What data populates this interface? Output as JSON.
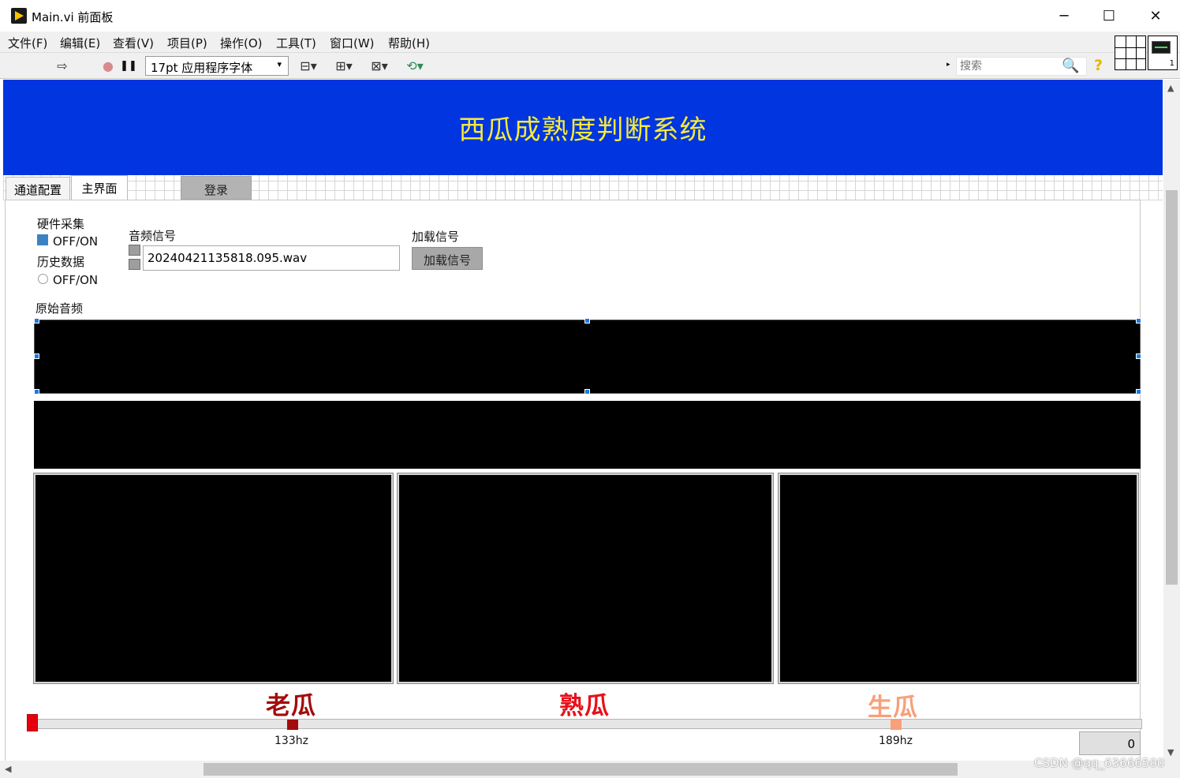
{
  "window": {
    "title": "Main.vi 前面板",
    "minimize": "─",
    "maximize": "☐",
    "close": "✕"
  },
  "menu": [
    "文件(F)",
    "编辑(E)",
    "查看(V)",
    "项目(P)",
    "操作(O)",
    "工具(T)",
    "窗口(W)",
    "帮助(H)"
  ],
  "toolbar": {
    "run_icon": "⇨",
    "abort_icon": "●",
    "pause_icon": "❚❚",
    "font": "17pt 应用程序字体",
    "font_arrow": "▾",
    "align_icon": "⊟▾",
    "distribute_icon": "⊞▾",
    "resize_icon": "⊠▾",
    "reorder_icon": "⟲▾",
    "search_placeholder": "搜索",
    "search_icon": "🔍",
    "help_icon": "?",
    "vi_icon_number": "1"
  },
  "banner": {
    "title": "西瓜成熟度判断系统"
  },
  "tabs": [
    {
      "label": "通道配置"
    },
    {
      "label": "主界面"
    }
  ],
  "login_button": "登录",
  "controls": {
    "hardware_label": "硬件采集",
    "hardware_toggle": "OFF/ON",
    "history_label": "历史数据",
    "history_toggle": "OFF/ON",
    "audio_label": "音频信号",
    "audio_path": "20240421135818.095.wav",
    "load_label": "加载信号",
    "load_button": "加载信号",
    "raw_audio_label": "原始音频"
  },
  "categories": [
    {
      "label": "老瓜",
      "color": "#a30c0c"
    },
    {
      "label": "熟瓜",
      "color": "#e8101a"
    },
    {
      "label": "生瓜",
      "color": "#f7a07a"
    }
  ],
  "slider": {
    "markers": [
      {
        "label": "133hz",
        "color": "#a30c0c"
      },
      {
        "label": "189hz",
        "color": "#f7a07a"
      }
    ],
    "value": "0"
  },
  "watermark": "CSDN @qq_63666500"
}
